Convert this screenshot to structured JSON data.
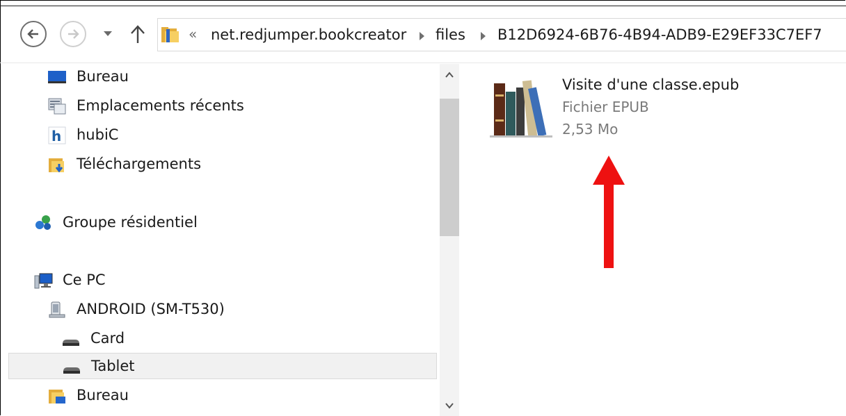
{
  "toolbar": {
    "back_icon": "back-arrow-icon",
    "forward_icon": "forward-arrow-icon",
    "recent_icon": "chevron-down-icon",
    "up_icon": "up-arrow-icon"
  },
  "address": {
    "overflow": "«",
    "crumbs": [
      "net.redjumper.bookcreator",
      "files",
      "B12D6924-6B76-4B94-ADB9-E29EF33C7EF7"
    ]
  },
  "tree": {
    "items": [
      {
        "label": "Bureau",
        "icon": "desktop-icon"
      },
      {
        "label": "Emplacements récents",
        "icon": "recent-places-icon"
      },
      {
        "label": "hubiC",
        "icon": "hubic-icon"
      },
      {
        "label": "Téléchargements",
        "icon": "downloads-folder-icon"
      },
      {
        "label": "Groupe résidentiel",
        "icon": "homegroup-icon"
      },
      {
        "label": "Ce PC",
        "icon": "computer-icon"
      },
      {
        "label": "ANDROID (SM-T530)",
        "icon": "android-device-icon"
      },
      {
        "label": "Card",
        "icon": "storage-drive-icon"
      },
      {
        "label": "Tablet",
        "icon": "storage-drive-icon",
        "selected": true
      },
      {
        "label": "Bureau",
        "icon": "desktop-folder-icon"
      }
    ]
  },
  "file": {
    "name": "Visite d'une classe.epub",
    "type": "Fichier EPUB",
    "size": "2,53 Mo",
    "icon": "epub-books-icon"
  },
  "colors": {
    "arrow": "#ee1111",
    "selection": "#f1f1f1",
    "folder": "#e8b84a"
  }
}
